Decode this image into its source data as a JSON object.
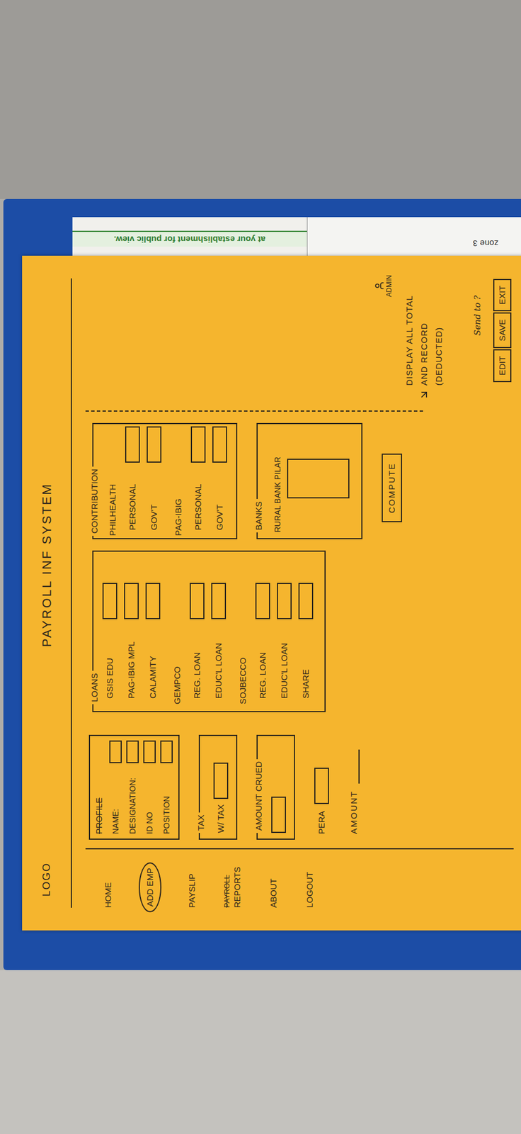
{
  "backdrop": {
    "notice": "at your establishment for public view.",
    "note": "zone 3"
  },
  "sketch": {
    "logo": "LOGO",
    "title": "PAYROLL INF SYSTEM",
    "user": {
      "label": "ADMIN"
    },
    "nav": [
      {
        "label": "HOME",
        "struck": "",
        "selected": false
      },
      {
        "label": "ADD EMP",
        "struck": "",
        "selected": true
      },
      {
        "label": "PAYSLIP",
        "struck": "",
        "selected": false
      },
      {
        "label": "REPORTS",
        "struck": "PAYROLL",
        "selected": false
      },
      {
        "label": "ABOUT",
        "struck": "",
        "selected": false
      },
      {
        "label": "LOGOUT",
        "struck": "",
        "selected": false
      }
    ],
    "profile": {
      "title": "PROFILE",
      "struck": true,
      "fields": [
        "NAME:",
        "DESIGNATION:",
        "ID NO",
        "POSITION"
      ]
    },
    "tax": {
      "title": "TAX",
      "field": "W/ TAX"
    },
    "accrued": {
      "title": "AMOUNT CRUED"
    },
    "pera": "PERA",
    "amount": "AMOUNT",
    "loans": {
      "title": "LOANS",
      "items": [
        {
          "label": "GSIS EDU",
          "kind": "field"
        },
        {
          "label": "PAG-IBIG MPL",
          "kind": "field"
        },
        {
          "label": "CALAMITY",
          "kind": "field"
        },
        {
          "label": "GEMPCO",
          "kind": "header"
        },
        {
          "label": "REG. LOAN",
          "kind": "field"
        },
        {
          "label": "EDUC'L LOAN",
          "kind": "field"
        },
        {
          "label": "SOJBECCO",
          "kind": "header"
        },
        {
          "label": "REG. LOAN",
          "kind": "field"
        },
        {
          "label": "EDUC'L LOAN",
          "kind": "field"
        },
        {
          "label": "SHARE",
          "kind": "field"
        }
      ]
    },
    "contribution": {
      "title": "CONTRIBUTION",
      "items": [
        {
          "label": "PHILHEALTH",
          "kind": "header"
        },
        {
          "label": "PERSONAL",
          "kind": "field"
        },
        {
          "label": "GOV'T",
          "kind": "field"
        },
        {
          "label": "PAG-IBIG",
          "kind": "header"
        },
        {
          "label": "PERSONAL",
          "kind": "field"
        },
        {
          "label": "GOV'T",
          "kind": "field"
        }
      ]
    },
    "banks": {
      "title": "BANKS",
      "items": [
        "RURAL BANK PILAR"
      ]
    },
    "compute": "COMPUTE",
    "note": [
      "DISPLAY ALL TOTAL",
      "AND RECORD",
      "(DEDUCTED)"
    ],
    "send": "Send to ?",
    "buttons": [
      "EDIT",
      "SAVE",
      "EXIT"
    ]
  }
}
